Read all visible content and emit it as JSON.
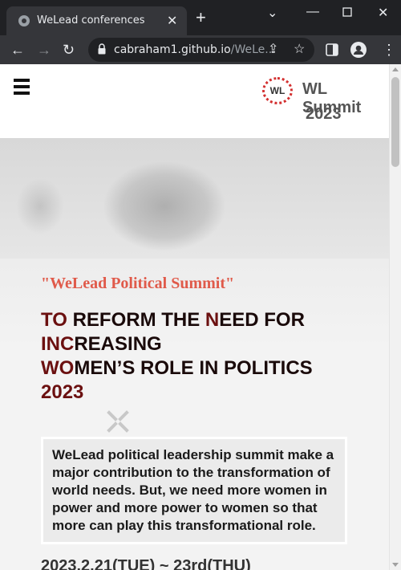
{
  "browser": {
    "tab_title": "WeLead conferences",
    "url_main": "cabraham1.github.io",
    "url_rest": "/WeLe..."
  },
  "header": {
    "logo_text": "WL",
    "brand_line1": "WL Summit",
    "brand_line2": "2023"
  },
  "hero": {
    "tagline": "\"WeLead Political Summit\"",
    "headline": {
      "line1_a": "TO",
      "line1_b": " REFORM THE ",
      "line1_c": "N",
      "line1_d": "EED FOR",
      "line2_a": "INC",
      "line2_b": "REASING",
      "line3_a": "WO",
      "line3_b": "MEN’S ROLE IN POLITICS",
      "line4": "2023"
    },
    "quote": "WeLead political leadership summit make a major contribution to the transformation of world needs. But, we need more women in power and more power to women so that more can play this transformational role.",
    "date": "2023.2.21(TUE) ~ 23rd(THU)"
  },
  "colors": {
    "accent_red": "#e05a4a",
    "headline_dark_red": "#6b1010",
    "logo_ring": "#d32f2f"
  }
}
